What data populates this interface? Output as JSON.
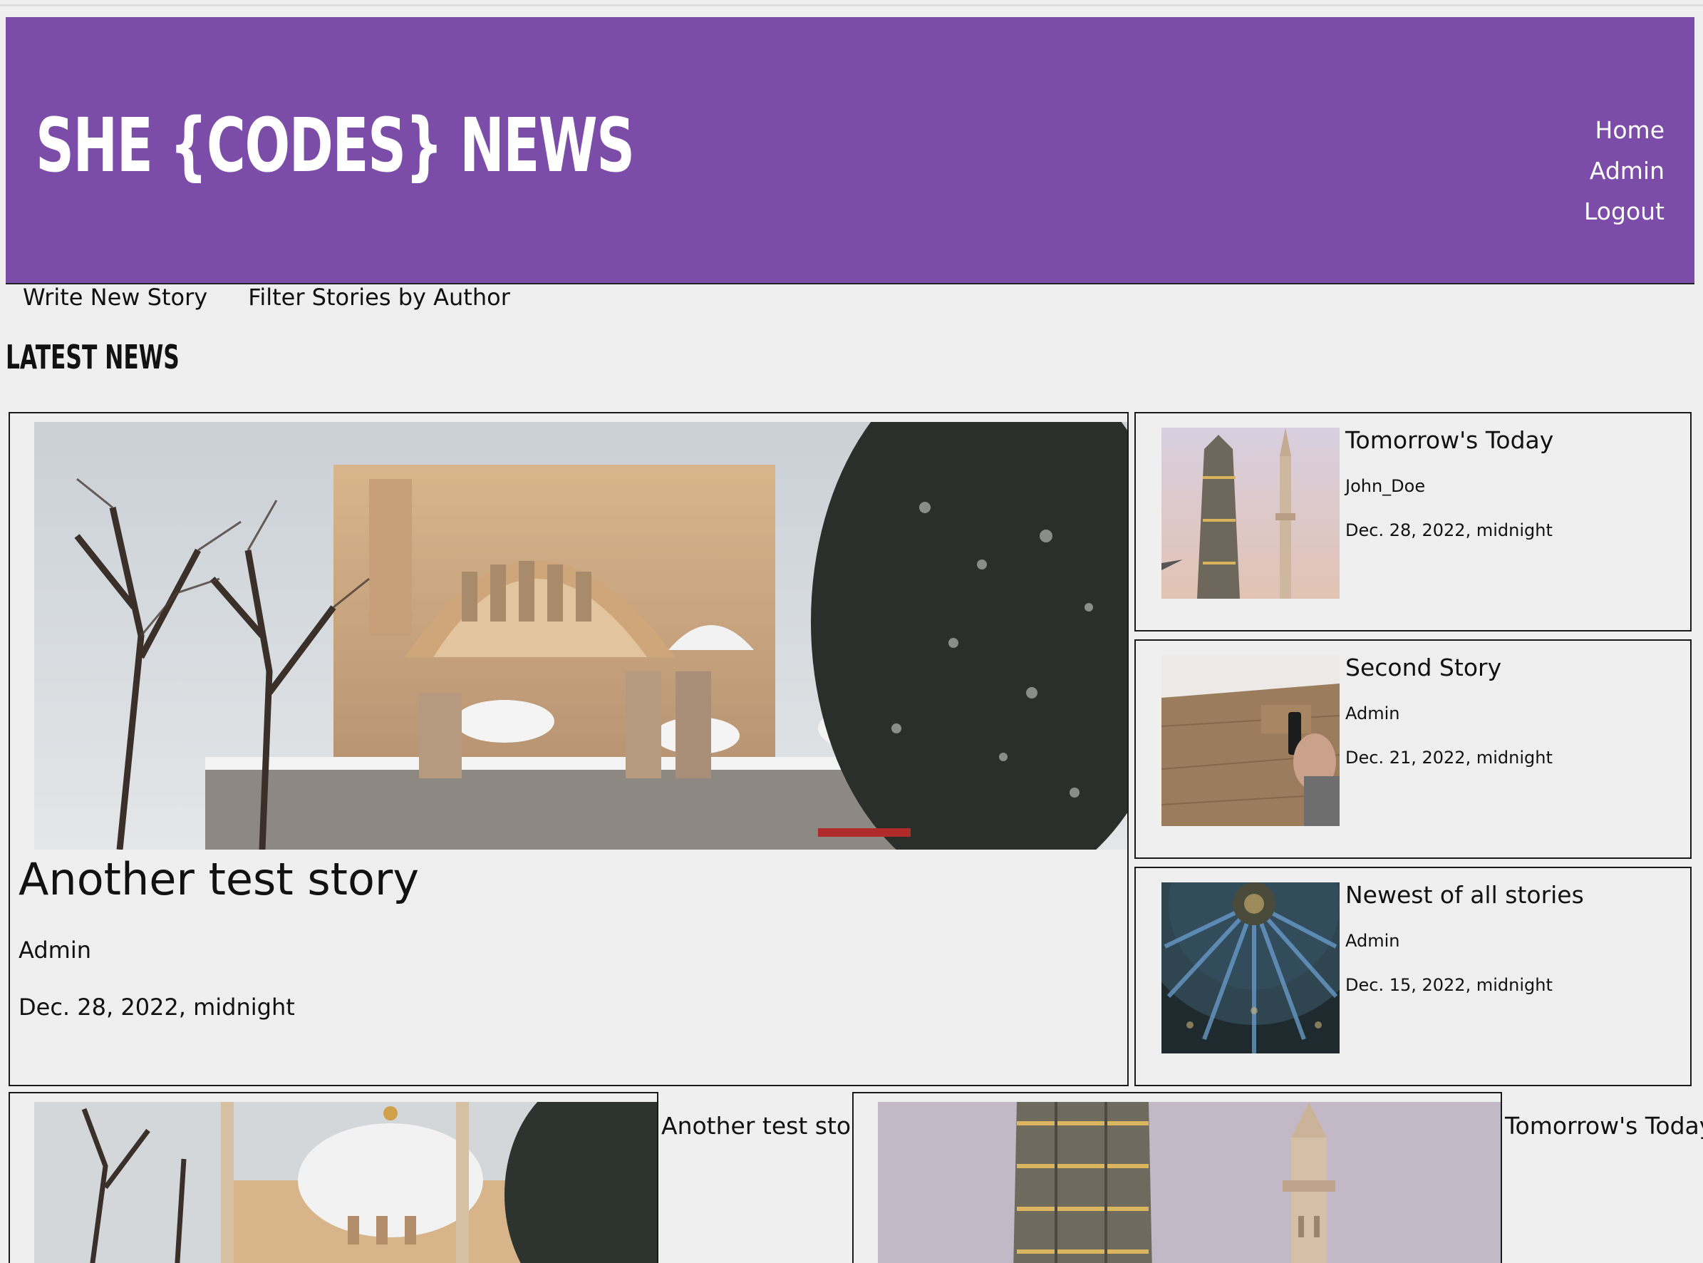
{
  "header": {
    "brand": "SHE {CODES} NEWS",
    "nav": [
      "Home",
      "Admin",
      "Logout"
    ]
  },
  "subnav": [
    "Write New Story",
    "Filter Stories by Author"
  ],
  "section_title": "LATEST NEWS",
  "feature": {
    "title": "Another test story",
    "author": "Admin",
    "date": "Dec. 28, 2022, midnight"
  },
  "side_stories": [
    {
      "title": "Tomorrow's Today",
      "author": "John_Doe",
      "date": "Dec. 28, 2022, midnight"
    },
    {
      "title": "Second Story",
      "author": "Admin",
      "date": "Dec. 21, 2022, midnight"
    },
    {
      "title": "Newest of all stories",
      "author": "Admin",
      "date": "Dec. 15, 2022, midnight"
    }
  ],
  "bottom_stories": [
    {
      "title": "Another test story"
    },
    {
      "title": "Tomorrow's Today"
    }
  ],
  "colors": {
    "header_bg": "#7b4ca8",
    "page_bg": "#efefef",
    "text": "#111111"
  }
}
